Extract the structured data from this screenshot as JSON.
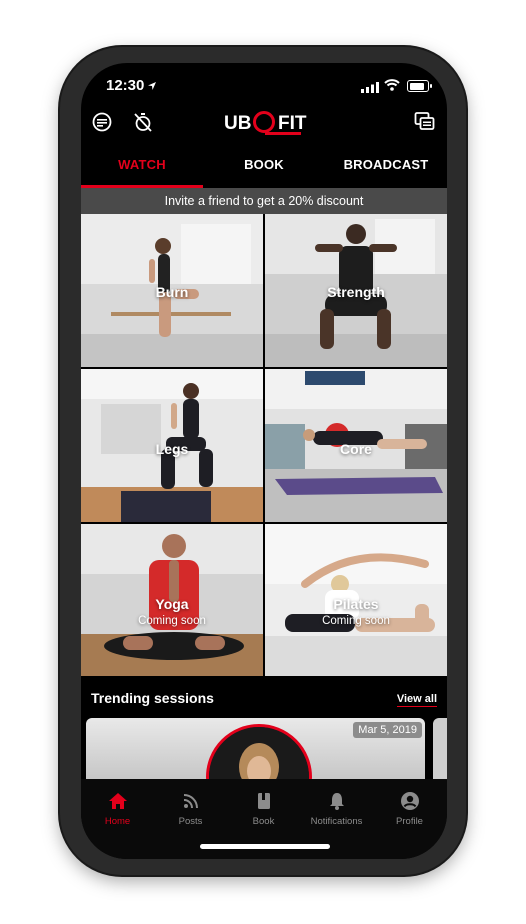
{
  "status_bar": {
    "time": "12:30"
  },
  "app": {
    "logo_left": "UB",
    "logo_right": "FIT",
    "brand_color": "#e3001b"
  },
  "tabs": [
    {
      "label": "WATCH",
      "active": true
    },
    {
      "label": "BOOK",
      "active": false
    },
    {
      "label": "BROADCAST",
      "active": false
    }
  ],
  "banner": {
    "text": "Invite a friend to get a 20% discount"
  },
  "categories": [
    {
      "label": "Burn",
      "subtitle": ""
    },
    {
      "label": "Strength",
      "subtitle": ""
    },
    {
      "label": "Legs",
      "subtitle": ""
    },
    {
      "label": "Core",
      "subtitle": ""
    },
    {
      "label": "Yoga",
      "subtitle": "Coming soon"
    },
    {
      "label": "Pilates",
      "subtitle": "Coming soon"
    }
  ],
  "trending": {
    "title": "Trending sessions",
    "view_all": "View all",
    "cards": [
      {
        "date": "Mar 5, 2019"
      }
    ]
  },
  "bottom_nav": [
    {
      "label": "Home",
      "icon": "home-icon",
      "active": true
    },
    {
      "label": "Posts",
      "icon": "rss-icon",
      "active": false
    },
    {
      "label": "Book",
      "icon": "book-icon",
      "active": false
    },
    {
      "label": "Notifications",
      "icon": "bell-icon",
      "active": false
    },
    {
      "label": "Profile",
      "icon": "profile-icon",
      "active": false
    }
  ]
}
